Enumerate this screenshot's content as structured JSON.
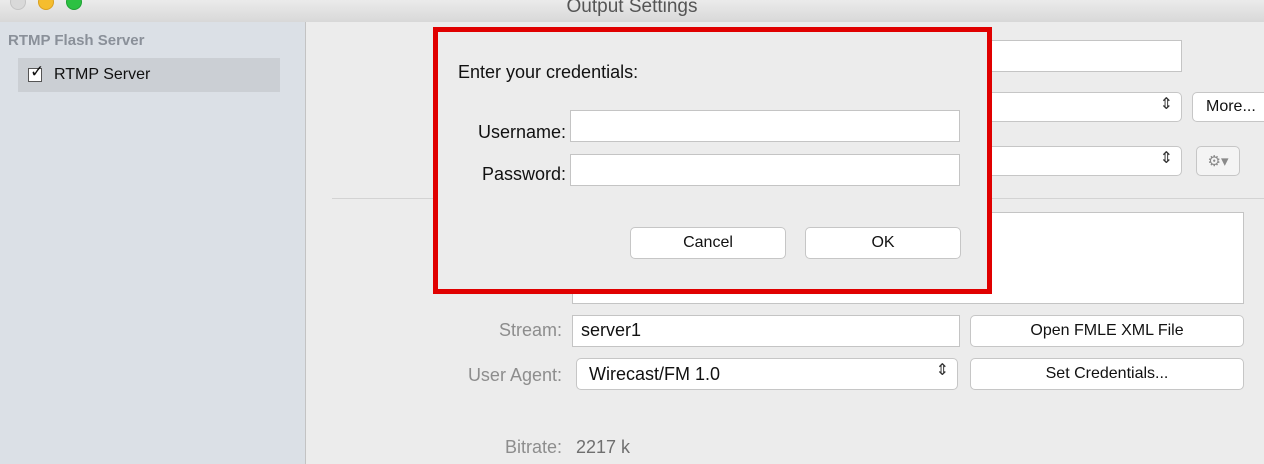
{
  "window": {
    "title": "Output Settings"
  },
  "sidebar": {
    "header": "RTMP Flash Server",
    "items": [
      {
        "label": "RTMP Server",
        "checked": true
      }
    ]
  },
  "main": {
    "more_label": "More...",
    "stream_label": "Stream:",
    "stream_value": "server1",
    "open_fmle_label": "Open FMLE XML File",
    "user_agent_label": "User Agent:",
    "user_agent_value": "Wirecast/FM 1.0",
    "set_credentials_label": "Set Credentials...",
    "bitrate_label": "Bitrate:",
    "bitrate_value": "2217 k"
  },
  "dialog": {
    "title": "Enter your credentials:",
    "username_label": "Username:",
    "username_value": "",
    "password_label": "Password:",
    "password_value": "",
    "cancel_label": "Cancel",
    "ok_label": "OK",
    "highlight_color": "#e00000"
  }
}
